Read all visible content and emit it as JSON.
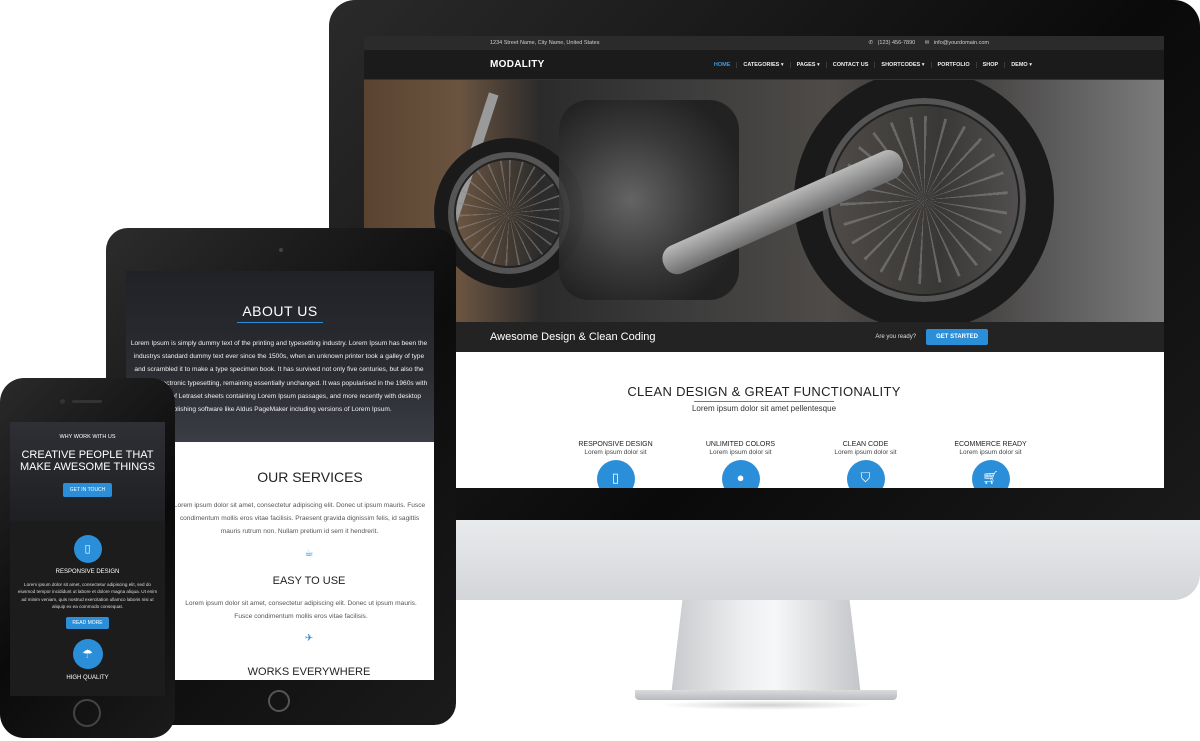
{
  "desktop": {
    "topbar": {
      "address": "1234 Street Name, City Name, United States",
      "phone": "(123) 456-7890",
      "email": "info@yourdomain.com"
    },
    "logo": "MODALITY",
    "nav": [
      "HOME",
      "CATEGORIES ▾",
      "PAGES ▾",
      "CONTACT US",
      "SHORTCODES ▾",
      "PORTFOLIO",
      "SHOP",
      "DEMO ▾"
    ],
    "cta": {
      "title": "Awesome Design & Clean Coding",
      "question": "Are you ready?",
      "button": "GET STARTED"
    },
    "features": {
      "title": "CLEAN DESIGN & GREAT FUNCTIONALITY",
      "subtitle": "Lorem ipsum dolor sit amet pellentesque",
      "items": [
        {
          "name": "RESPONSIVE DESIGN",
          "desc": "Lorem ipsum dolor sit",
          "icon": "tablet-icon"
        },
        {
          "name": "UNLIMITED COLORS",
          "desc": "Lorem ipsum dolor sit",
          "icon": "droplet-icon"
        },
        {
          "name": "CLEAN CODE",
          "desc": "Lorem ipsum dolor sit",
          "icon": "html5-icon"
        },
        {
          "name": "ECOMMERCE READY",
          "desc": "Lorem ipsum dolor sit",
          "icon": "cart-icon"
        }
      ]
    }
  },
  "tablet": {
    "about_title": "ABOUT US",
    "about_text": "Lorem Ipsum is simply dummy text of the printing and typesetting industry. Lorem Ipsum has been the industrys standard dummy text ever since the 1500s, when an unknown printer took a galley of type and scrambled it to make a type specimen book. It has survived not only five centuries, but also the leap into electronic typesetting, remaining essentially unchanged. It was popularised in the 1960s with the release of Letraset sheets containing Lorem Ipsum passages, and more recently with desktop publishing software like Aldus PageMaker including versions of Lorem Ipsum.",
    "services_title": "OUR SERVICES",
    "services_text": "Lorem ipsum dolor sit amet, consectetur adipiscing elit. Donec ut ipsum mauris. Fusce condimentum mollis eros vitae facilisis. Praesent gravida dignissim felis, id sagittis mauris rutrum non. Nullam pretium id sem it hendrerit.",
    "easy_title": "EASY TO USE",
    "easy_text": "Lorem ipsum dolor sit amet, consectetur adipiscing elit. Donec ut ipsum mauris. Fusce condimentum mollis eros vitae facilisis.",
    "works_title": "WORKS EVERYWHERE"
  },
  "phone": {
    "why": "WHY WORK WITH US",
    "headline": "CREATIVE PEOPLE THAT MAKE AWESOME THINGS",
    "button": "GET IN TOUCH",
    "feature1": "RESPONSIVE DESIGN",
    "feature1_text": "Lorem ipsum dolor sit amet, consectetur adipiscing elit, sed do eiusmod tempor incididunt ut labore et dolore magna aliqua. Ut enim ad minim veniam, quis nostrud exercitation ullamco laboris nisi ut aliquip ex ea commodo consequat.",
    "read_more": "READ MORE",
    "feature2": "HIGH QUALITY"
  }
}
